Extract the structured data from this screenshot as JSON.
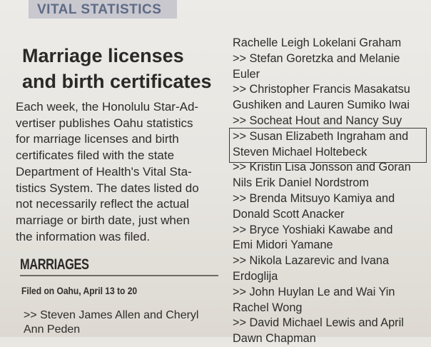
{
  "banner": "VITAL STATISTICS",
  "headline": [
    "Marriage licenses",
    "and birth certificates"
  ],
  "intro_lines": [
    "Each week, the Honolulu Star-Ad-",
    "vertiser publishes Oahu statistics",
    "for marriage licenses and birth",
    "certificates filed with the state",
    "Department of Health's Vital Sta-",
    "tistics System. The dates listed do",
    "not necessarily reflect the actual",
    "marriage or birth date, just when",
    "the information was filed."
  ],
  "section_heading": "MARRIAGES",
  "filed_line": "Filed on Oahu, April 13 to 20",
  "left_entries": [
    ">> Steven James Allen and Cheryl",
    "Ann Peden"
  ],
  "right_entries": [
    "Rachelle Leigh Lokelani Graham",
    ">> Stefan Goretzka and Melanie",
    "Euler",
    ">> Christopher Francis Masakatsu",
    "Gushiken and Lauren Sumiko Iwai",
    ">> Socheat Hout and Nancy Suy",
    ">> Susan Elizabeth Ingraham and",
    "Steven Michael Holtebeck",
    ">> Kristin Lisa Jonsson and Goran",
    "Nils Erik Daniel Nordstrom",
    ">> Brenda Mitsuyo Kamiya and",
    "Donald Scott Anacker",
    ">> Bryce Yoshiaki Kawabe and",
    "Emi Midori Yamane",
    ">> Nikola Lazarevic and Ivana",
    "Erdoglija",
    ">> John Huylan Le and Wai Yin",
    "Rachel Wong",
    ">> David Michael Lewis and April",
    "Dawn Chapman"
  ]
}
